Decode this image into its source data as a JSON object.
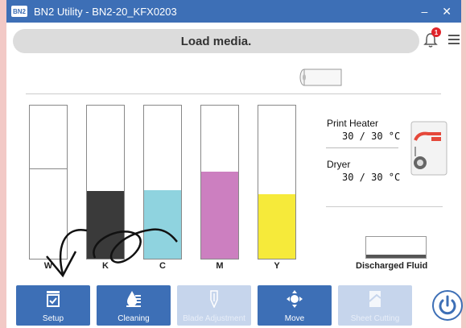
{
  "window": {
    "title": "BN2 Utility - BN2-20_KFX0203",
    "logo_text": "BN2",
    "minimize_glyph": "–",
    "close_glyph": "✕"
  },
  "status": {
    "message": "Load media.",
    "notification_count": "1"
  },
  "inks": [
    {
      "label": "W",
      "color": "#ffffff",
      "level": 0.59
    },
    {
      "label": "K",
      "color": "#3a3a3a",
      "level": 0.44
    },
    {
      "label": "C",
      "color": "#8fd3df",
      "level": 0.45
    },
    {
      "label": "M",
      "color": "#cc7fc0",
      "level": 0.57
    },
    {
      "label": "Y",
      "color": "#f6ea3a",
      "level": 0.42
    }
  ],
  "heaters": {
    "print_heater_label": "Print Heater",
    "print_heater_value": "30 / 30 °C",
    "dryer_label": "Dryer",
    "dryer_value": "30 / 30 °C"
  },
  "discharged": {
    "label": "Discharged Fluid",
    "level": 0.15
  },
  "toolbar": {
    "setup": "Setup",
    "cleaning": "Cleaning",
    "blade_adjustment": "Blade Adjustment",
    "move": "Move",
    "sheet_cutting": "Sheet Cutting"
  },
  "colors": {
    "accent": "#3d6fb6",
    "disabled": "#c6d5ec",
    "badge": "#e0242a"
  }
}
